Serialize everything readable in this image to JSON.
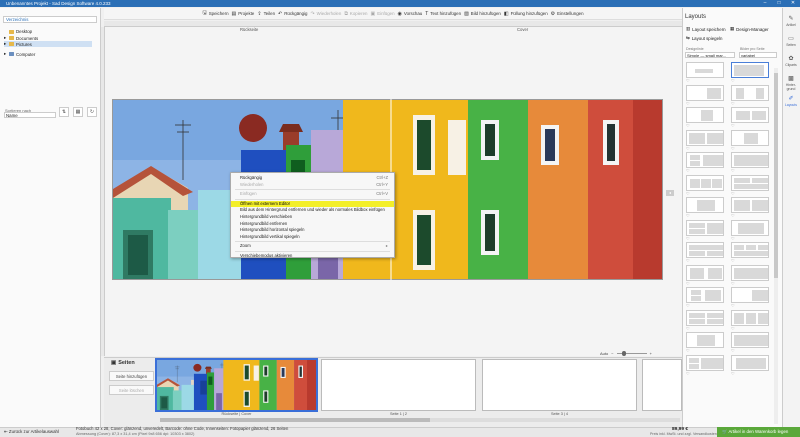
{
  "window": {
    "title": "Unbenanntes Projekt - Sad Design Software 4.0.233",
    "controls": [
      "–",
      "□",
      "✕"
    ]
  },
  "toolbar": [
    {
      "icon": "save-icon",
      "glyph": "🖫",
      "label": "Speichern",
      "enabled": true
    },
    {
      "icon": "projects-icon",
      "glyph": "▤",
      "label": "Projekte",
      "enabled": true
    },
    {
      "icon": "share-icon",
      "glyph": "⇪",
      "label": "Teilen",
      "enabled": true
    },
    {
      "icon": "undo-icon",
      "glyph": "↶",
      "label": "Rückgängig",
      "enabled": true
    },
    {
      "icon": "redo-icon",
      "glyph": "↷",
      "label": "Wiederholen",
      "enabled": false
    },
    {
      "icon": "copy-icon",
      "glyph": "⧉",
      "label": "Kopieren",
      "enabled": false
    },
    {
      "icon": "paste-icon",
      "glyph": "▣",
      "label": "Einfügen",
      "enabled": false
    },
    {
      "icon": "preview-icon",
      "glyph": "◉",
      "label": "Vorschau",
      "enabled": true
    },
    {
      "icon": "add-text-icon",
      "glyph": "T",
      "label": "Text hinzufügen",
      "enabled": true
    },
    {
      "icon": "add-image-icon",
      "glyph": "▨",
      "label": "Bild hinzufügen",
      "enabled": true
    },
    {
      "icon": "add-fill-icon",
      "glyph": "◧",
      "label": "Füllung hinzufügen",
      "enabled": true
    },
    {
      "icon": "settings-icon",
      "glyph": "⚙",
      "label": "Einstellungen",
      "enabled": true
    }
  ],
  "left": {
    "search_placeholder": "Verzeichnis",
    "tree": [
      {
        "label": "Desktop",
        "expander": "",
        "type": "folder",
        "selected": false
      },
      {
        "label": "Documents",
        "expander": "▸",
        "type": "folder",
        "selected": false
      },
      {
        "label": "Pictures",
        "expander": "▸",
        "type": "folder",
        "selected": true
      },
      {
        "label": "Computer",
        "expander": "▸",
        "type": "pc",
        "selected": false
      }
    ],
    "sort_label": "Sortieren nach",
    "sort_value": "Name",
    "sort_icons": [
      "⇅",
      "▦",
      "↻"
    ]
  },
  "canvas": {
    "back_label": "Rückseite",
    "cover_label": "Cover",
    "edge_arrow": "◂",
    "zoom_label": "Auto",
    "zoom_minus": "−",
    "zoom_plus": "+"
  },
  "context_menu": [
    {
      "label": "Rückgängig",
      "shortcut": "Ctrl+Z",
      "enabled": true,
      "highlight": false
    },
    {
      "label": "Wiederholen",
      "shortcut": "Ctrl+Y",
      "enabled": false,
      "highlight": false
    },
    {
      "sep": true
    },
    {
      "label": "Einfügen",
      "shortcut": "Ctrl+V",
      "enabled": false,
      "highlight": false
    },
    {
      "sep": true
    },
    {
      "label": "Öffnen mit externem Editor",
      "shortcut": "",
      "enabled": true,
      "highlight": true
    },
    {
      "label": "Bild aus dem Hintergrund entfernen und wieder als normales Bildbox einfügen",
      "shortcut": "",
      "enabled": true,
      "highlight": false
    },
    {
      "label": "Hintergrundbild verschieben",
      "shortcut": "",
      "enabled": true,
      "highlight": false
    },
    {
      "label": "Hintergrundbild entfernen",
      "shortcut": "",
      "enabled": true,
      "highlight": false
    },
    {
      "label": "Hintergrundbild horizontal spiegeln",
      "shortcut": "",
      "enabled": true,
      "highlight": false
    },
    {
      "label": "Hintergrundbild vertikal spiegeln",
      "shortcut": "",
      "enabled": true,
      "highlight": false
    },
    {
      "sep": true
    },
    {
      "label": "Zoom",
      "shortcut": "▸",
      "enabled": true,
      "highlight": false
    },
    {
      "sep": true
    },
    {
      "label": "Verschiebemodus aktivieren",
      "shortcut": "",
      "enabled": true,
      "highlight": false
    }
  ],
  "pages": {
    "title": "Seiten",
    "add_label": "Seite hinzufügen",
    "remove_label": "Seite löschen",
    "thumbs": [
      {
        "label": "Rückseite | Cover",
        "active": true
      },
      {
        "label": "Seite 1 | 2",
        "active": false
      },
      {
        "label": "Seite 3 | 4",
        "active": false
      },
      {
        "label": "",
        "active": false
      }
    ]
  },
  "status": {
    "back_label": "Zurück zur Artikelauswahl",
    "product": "Fotobuch 42 x 28, Cover: glänzend, unveredelt, Barcode: ohne Code, Innenseiten: Fotopapier glänzend, 26 Seiten",
    "product2": "Abmessung (Cover): 87,3 x 31,4 cm (Pixel 9x8 656 dpi: 10303 x 3802)",
    "price": "89,99 €",
    "price_note": "Preis inkl. MwSt. und zzgl. Versandkosten",
    "cart_label": "Artikel in den Warenkorb legen"
  },
  "right": {
    "title": "Layouts",
    "save_layout": "Layout speichern",
    "design_manager": "Design-Manager",
    "mirror_layout": "Layout spiegeln",
    "design_label": "Designlinie",
    "design_value": "Simple — small mar...",
    "count_label": "Bilder pro Seite",
    "count_value": "variabel",
    "heart": "♡"
  },
  "sidebar": [
    {
      "label": "Artikel",
      "glyph": "✎",
      "active": false
    },
    {
      "label": "Seiten",
      "glyph": "▭",
      "active": false
    },
    {
      "label": "Cliparts",
      "glyph": "✿",
      "active": false
    },
    {
      "label": "Hinter-grund",
      "glyph": "▩",
      "active": false
    },
    {
      "label": "Layouts",
      "glyph": "✐",
      "active": true
    }
  ]
}
